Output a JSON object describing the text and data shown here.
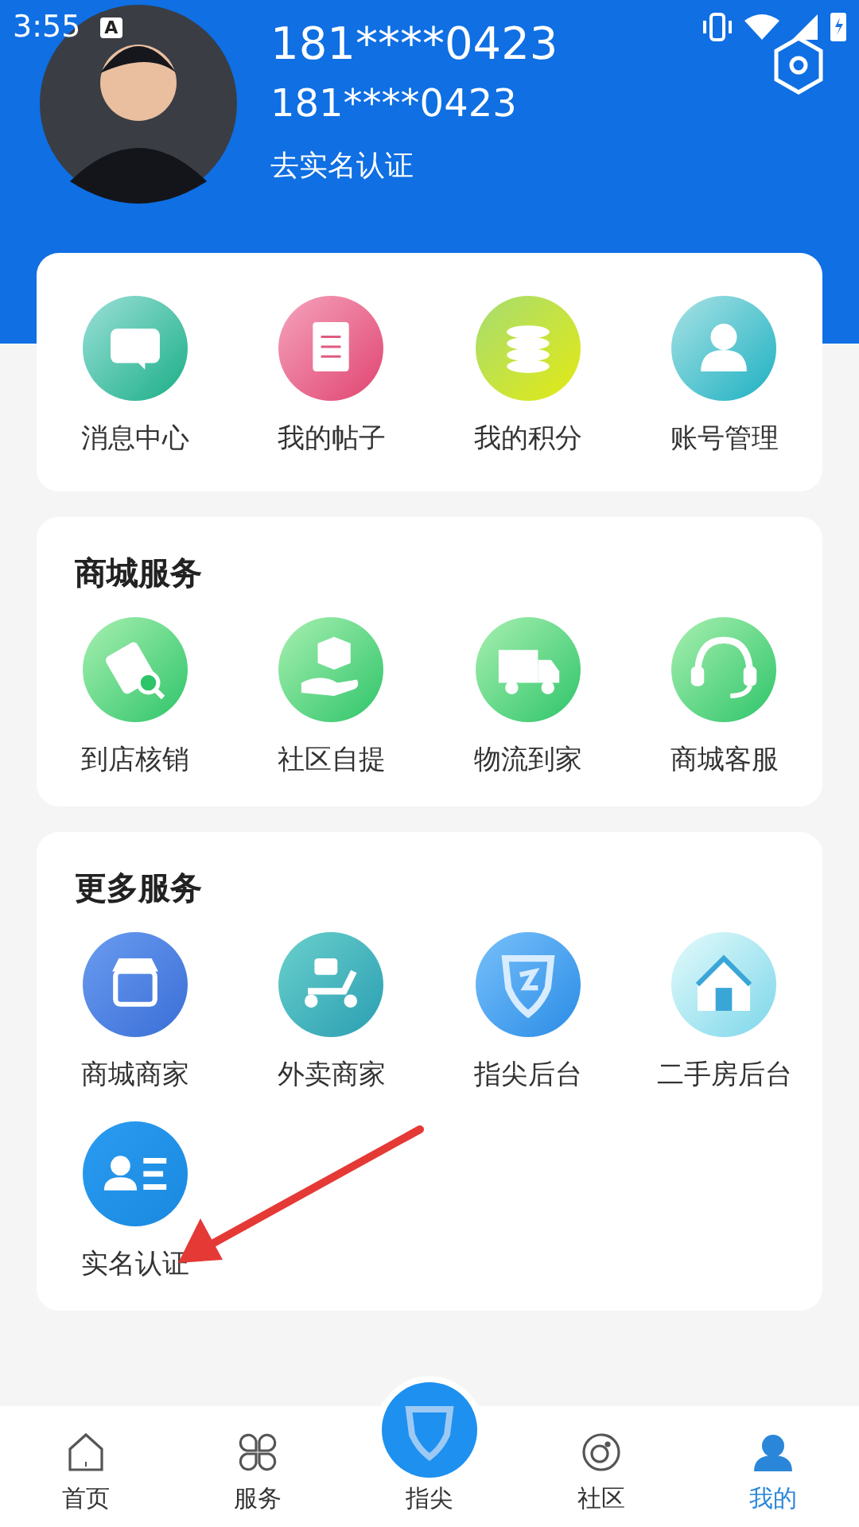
{
  "status_bar": {
    "time": "3:55",
    "notice": "A"
  },
  "profile": {
    "phone": "181****0423",
    "account": "181****0423",
    "verify_link": "去实名认证"
  },
  "quick_menu": [
    {
      "label": "消息中心",
      "kind": "chat"
    },
    {
      "label": "我的帖子",
      "kind": "post"
    },
    {
      "label": "我的积分",
      "kind": "coins"
    },
    {
      "label": "账号管理",
      "kind": "account"
    }
  ],
  "sections": [
    {
      "title": "商城服务",
      "items": [
        {
          "label": "到店核销",
          "kind": "ticket"
        },
        {
          "label": "社区自提",
          "kind": "package"
        },
        {
          "label": "物流到家",
          "kind": "truck"
        },
        {
          "label": "商城客服",
          "kind": "headset"
        }
      ]
    },
    {
      "title": "更多服务",
      "items": [
        {
          "label": "商城商家",
          "kind": "shop"
        },
        {
          "label": "外卖商家",
          "kind": "scooter"
        },
        {
          "label": "指尖后台",
          "kind": "shield"
        },
        {
          "label": "二手房后台",
          "kind": "house"
        },
        {
          "label": "实名认证",
          "kind": "idcard"
        }
      ]
    }
  ],
  "annotation": {
    "kind": "arrow"
  },
  "nav": [
    {
      "label": "首页",
      "kind": "home",
      "selected": false
    },
    {
      "label": "服务",
      "kind": "grid",
      "selected": false
    },
    {
      "label": "指尖",
      "kind": "center",
      "selected": false
    },
    {
      "label": "社区",
      "kind": "community",
      "selected": false
    },
    {
      "label": "我的",
      "kind": "user",
      "selected": true
    }
  ]
}
